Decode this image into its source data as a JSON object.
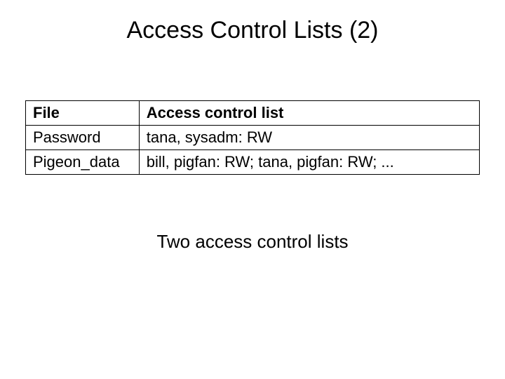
{
  "title": "Access Control Lists (2)",
  "table": {
    "headers": {
      "col0": "File",
      "col1": "Access control list"
    },
    "rows": [
      {
        "file": "Password",
        "acl": "tana, sysadm: RW"
      },
      {
        "file": "Pigeon_data",
        "acl": "bill, pigfan: RW;  tana, pigfan: RW; ..."
      }
    ]
  },
  "caption": "Two access control lists"
}
